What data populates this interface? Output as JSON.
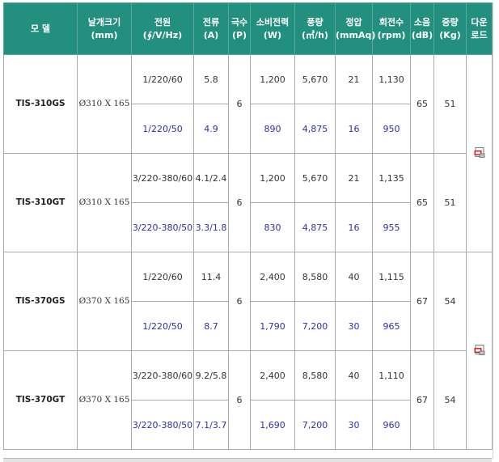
{
  "header": {
    "model": "모 델",
    "blade_l1": "날개크기",
    "blade_l2": "(mm)",
    "power_l1": "전원",
    "power_l2": "(∮/V/Hz)",
    "current_l1": "전류",
    "current_l2": "(A)",
    "poles_l1": "극수",
    "poles_l2": "(P)",
    "consumption_l1": "소비전력",
    "consumption_l2": "(W)",
    "airflow_l1": "풍량",
    "airflow_l2": "(㎥/h)",
    "pressure_l1": "정압",
    "pressure_l2": "(mmAq)",
    "rpm_l1": "회전수",
    "rpm_l2": "(rpm)",
    "noise_l1": "소음",
    "noise_l2": "(dB)",
    "weight_l1": "중량",
    "weight_l2": "(Kg)",
    "download_l1": "다운",
    "download_l2": "로드"
  },
  "models": [
    {
      "name": "TIS-310GS",
      "size": "Ø310 X 165",
      "poles": "6",
      "noise": "65",
      "weight": "51",
      "rows": [
        {
          "power": "1/220/60",
          "current": "5.8",
          "consumption": "1,200",
          "airflow": "5,670",
          "pressure": "21",
          "rpm": "1,130"
        },
        {
          "power": "1/220/50",
          "current": "4.9",
          "consumption": "890",
          "airflow": "4,875",
          "pressure": "16",
          "rpm": "950"
        }
      ]
    },
    {
      "name": "TIS-310GT",
      "size": "Ø310 X 165",
      "poles": "6",
      "noise": "65",
      "weight": "51",
      "rows": [
        {
          "power": "3/220-380/60",
          "current": "4.1/2.4",
          "consumption": "1,200",
          "airflow": "5,670",
          "pressure": "21",
          "rpm": "1,135"
        },
        {
          "power": "3/220-380/50",
          "current": "3.3/1.8",
          "consumption": "830",
          "airflow": "4,875",
          "pressure": "16",
          "rpm": "955"
        }
      ]
    },
    {
      "name": "TIS-370GS",
      "size": "Ø370 X 165",
      "poles": "6",
      "noise": "67",
      "weight": "54",
      "rows": [
        {
          "power": "1/220/60",
          "current": "11.4",
          "consumption": "2,400",
          "airflow": "8,580",
          "pressure": "40",
          "rpm": "1,115"
        },
        {
          "power": "1/220/50",
          "current": "8.7",
          "consumption": "1,790",
          "airflow": "7,200",
          "pressure": "30",
          "rpm": "965"
        }
      ]
    },
    {
      "name": "TIS-370GT",
      "size": "Ø370 X 165",
      "poles": "6",
      "noise": "67",
      "weight": "54",
      "rows": [
        {
          "power": "3/220-380/60",
          "current": "9.2/5.8",
          "consumption": "2,400",
          "airflow": "8,580",
          "pressure": "40",
          "rpm": "1,110"
        },
        {
          "power": "3/220-380/50",
          "current": "7.1/3.7",
          "consumption": "1,690",
          "airflow": "7,200",
          "pressure": "30",
          "rpm": "960"
        }
      ]
    }
  ],
  "downloads": [
    {
      "icon": "pdf-download-icon"
    },
    {
      "icon": "pdf-download-icon"
    }
  ],
  "colors": {
    "header_bg": "#238f7e",
    "header_text": "#ffffff",
    "secondary_row_text": "#2f2fb0",
    "border": "#a9a9a9"
  }
}
